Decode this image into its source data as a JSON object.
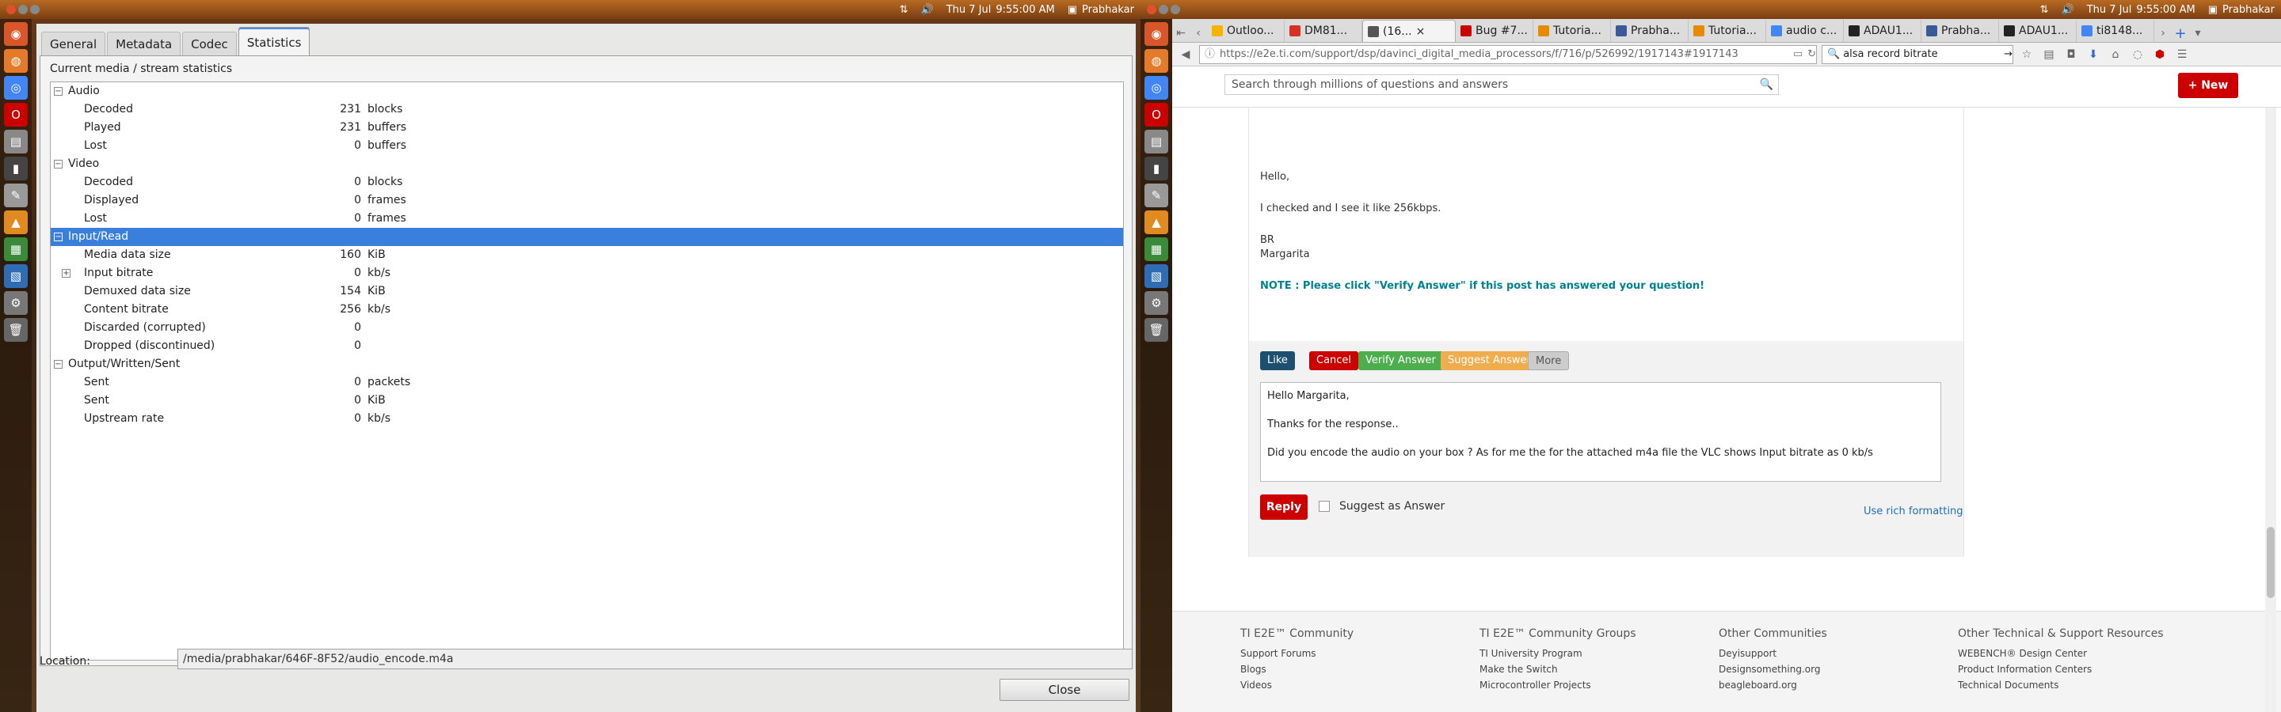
{
  "topbar_left": {
    "date": "Thu  7 Jul",
    "time": "9:55:00 AM",
    "user": "Prabhakar"
  },
  "topbar_right": {
    "date": "Thu  7 Jul",
    "time": "9:55:00 AM",
    "user": "Prabhakar"
  },
  "vlc": {
    "tabs": [
      "General",
      "Metadata",
      "Codec",
      "Statistics"
    ],
    "active_tab": "Statistics",
    "header": "Current media / stream statistics",
    "rows": [
      {
        "label": "Audio",
        "value": "",
        "unit": "",
        "level": 0,
        "expander": "−"
      },
      {
        "label": "Decoded",
        "value": "231",
        "unit": "blocks",
        "level": 1
      },
      {
        "label": "Played",
        "value": "231",
        "unit": "buffers",
        "level": 1
      },
      {
        "label": "Lost",
        "value": "0",
        "unit": "buffers",
        "level": 1
      },
      {
        "label": "Video",
        "value": "",
        "unit": "",
        "level": 0,
        "expander": "−"
      },
      {
        "label": "Decoded",
        "value": "0",
        "unit": "blocks",
        "level": 1
      },
      {
        "label": "Displayed",
        "value": "0",
        "unit": "frames",
        "level": 1
      },
      {
        "label": "Lost",
        "value": "0",
        "unit": "frames",
        "level": 1
      },
      {
        "label": "Input/Read",
        "value": "",
        "unit": "",
        "level": 0,
        "expander": "−",
        "selected": true
      },
      {
        "label": "Media data size",
        "value": "160",
        "unit": "KiB",
        "level": 1
      },
      {
        "label": "Input bitrate",
        "value": "0",
        "unit": "kb/s",
        "level": 1,
        "expander": "+"
      },
      {
        "label": "Demuxed data size",
        "value": "154",
        "unit": "KiB",
        "level": 1
      },
      {
        "label": "Content bitrate",
        "value": "256",
        "unit": "kb/s",
        "level": 1
      },
      {
        "label": "Discarded (corrupted)",
        "value": "0",
        "unit": "",
        "level": 1
      },
      {
        "label": "Dropped (discontinued)",
        "value": "0",
        "unit": "",
        "level": 1
      },
      {
        "label": "Output/Written/Sent",
        "value": "",
        "unit": "",
        "level": 0,
        "expander": "−"
      },
      {
        "label": "Sent",
        "value": "0",
        "unit": "packets",
        "level": 1
      },
      {
        "label": "Sent",
        "value": "0",
        "unit": "KiB",
        "level": 1
      },
      {
        "label": "Upstream rate",
        "value": "0",
        "unit": "kb/s",
        "level": 1
      }
    ],
    "location_label": "Location:",
    "location_value": "/media/prabhakar/646F-8F52/audio_encode.m4a",
    "close_label": "Close"
  },
  "firefox": {
    "tabs": [
      {
        "label": "Outloo...",
        "color": "#f4b400"
      },
      {
        "label": "DM81...",
        "color": "#d93025"
      },
      {
        "label": "(16...",
        "color": "#555",
        "active": true
      },
      {
        "label": "Bug #7...",
        "color": "#cc0000"
      },
      {
        "label": "Tutoria...",
        "color": "#e68a00"
      },
      {
        "label": "Prabha...",
        "color": "#3b5998"
      },
      {
        "label": "Tutoria...",
        "color": "#e68a00"
      },
      {
        "label": "audio c...",
        "color": "#4285f4"
      },
      {
        "label": "ADAU1...",
        "color": "#222"
      },
      {
        "label": "Prabha...",
        "color": "#3b5998"
      },
      {
        "label": "ADAU1...",
        "color": "#222"
      },
      {
        "label": "ti8148...",
        "color": "#4285f4"
      }
    ],
    "url": "https://e2e.ti.com/support/dsp/davinci_digital_media_processors/f/716/p/526992/1917143#1917143",
    "search_value": "alsa record bitrate",
    "site_search_placeholder": "Search through millions of questions and answers",
    "new_label": "New",
    "post_lines": [
      "Hello,",
      "I checked and I see it like 256kbps.",
      "BR",
      "Margarita"
    ],
    "note": "NOTE : Please click \"Verify Answer\" if this post has answered your question!",
    "buttons": {
      "like": "Like",
      "cancel": "Cancel",
      "verify": "Verify Answer",
      "suggest": "Suggest Answer",
      "more": "More"
    },
    "reply_lines": [
      "Hello Margarita,",
      "Thanks for the response..",
      "Did you encode the audio on your box ? As for me the for the attached m4a file the VLC shows Input bitrate as 0 kb/s"
    ],
    "reply_label": "Reply",
    "suggest_as_answer": "Suggest as Answer",
    "rich_formatting": "Use rich formatting",
    "footer": [
      {
        "heading": "TI E2E™ Community",
        "links": [
          "Support Forums",
          "Blogs",
          "Videos"
        ]
      },
      {
        "heading": "TI E2E™ Community Groups",
        "links": [
          "TI University Program",
          "Make the Switch",
          "Microcontroller Projects"
        ]
      },
      {
        "heading": "Other Communities",
        "links": [
          "Deyisupport",
          "Designsomething.org",
          "beagleboard.org"
        ]
      },
      {
        "heading": "Other Technical & Support Resources",
        "links": [
          "WEBENCH® Design Center",
          "Product Information Centers",
          "Technical Documents"
        ]
      }
    ]
  }
}
